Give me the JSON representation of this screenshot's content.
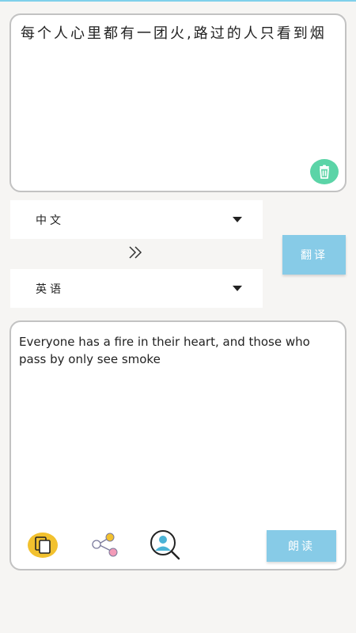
{
  "source": {
    "text": "每个人心里都有一团火,路过的人只看到烟"
  },
  "languages": {
    "from": "中文",
    "to": "英语"
  },
  "actions": {
    "translate_label": "翻译",
    "read_label": "朗读"
  },
  "output": {
    "text": "Everyone has a fire in their heart, and those who pass by only see smoke"
  },
  "icons": {
    "trash": "trash-icon",
    "swap": "double-chevron-right-icon",
    "copy": "copy-icon",
    "share": "share-icon",
    "search": "person-search-icon"
  },
  "colors": {
    "accent_blue": "#87cbe7",
    "trash_green": "#5bd4a7",
    "copy_yellow": "#f2c12e"
  }
}
